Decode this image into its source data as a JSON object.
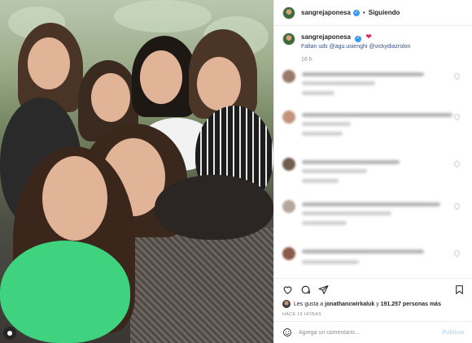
{
  "header": {
    "username": "sangrejaponesa",
    "separator": "•",
    "follow_status": "Siguiendo"
  },
  "caption": {
    "username": "sangrejaponesa",
    "text": "Faltan uds @agu.usienghi @vickydiazrolon",
    "time": "16 h"
  },
  "likes": {
    "prefix": "Les gusta a",
    "user": "jonathancwirkaluk",
    "connector": "y",
    "others": "191.257 personas más"
  },
  "posted_ago": "HACE 16 HORAS",
  "comment_box": {
    "placeholder": "Agrega un comentario...",
    "submit": "Publicar"
  },
  "colors": {
    "verified": "#3897f0",
    "link": "#385185",
    "heart": "#e0245e",
    "muted": "#8e8e8e"
  },
  "icons": [
    "verified-icon",
    "heart-icon",
    "comment-icon",
    "share-icon",
    "bookmark-icon",
    "emoji-icon",
    "profile-tag-icon"
  ]
}
